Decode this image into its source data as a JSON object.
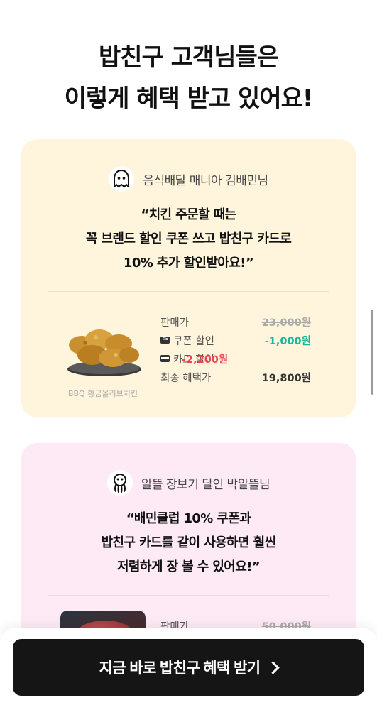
{
  "headline": {
    "line1": "밥친구 고객님들은",
    "line2": "이렇게 혜택 받고 있어요!"
  },
  "reviews": [
    {
      "persona": "음식배달 매니아 김배민님",
      "avatar_icon": "ghost-icon",
      "quote_lines": [
        "“치킨 주문할 때는",
        "꼭 브랜드 할인 쿠폰 쓰고 밥친구 카드로",
        "10% 추가 할인받아요!”"
      ],
      "product_caption": "BBQ 황금올리브치킨",
      "prices": {
        "list_label": "판매가",
        "list_value": "23,000원",
        "coupon_label": "쿠폰 할인",
        "coupon_value": "-1,000원",
        "card_label": "카드 할인",
        "card_value": "-2,200원",
        "final_label": "최종 혜택가",
        "final_value": "19,800원"
      },
      "colors": {
        "background": "#fff5dc"
      }
    },
    {
      "persona": "알뜰 장보기 달인 박알뜰님",
      "avatar_icon": "octopus-icon",
      "quote_lines": [
        "“배민클럽 10% 쿠폰과",
        "밥친구 카드를 같이 사용하면 훨씬",
        "저렴하게 장 볼 수 있어요!”"
      ],
      "prices": {
        "list_label": "판매가",
        "list_value": "50,000원"
      },
      "colors": {
        "background": "#fdeaf4"
      }
    }
  ],
  "cta": {
    "label": "지금 바로 밥친구 혜택 받기"
  },
  "colors": {
    "coupon": "#16b89a",
    "card": "#f04452",
    "cta_bg": "#151515"
  }
}
